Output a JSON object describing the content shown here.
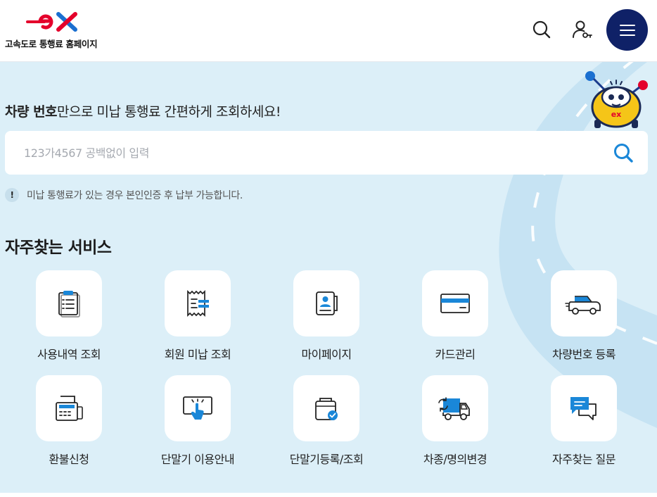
{
  "header": {
    "logo_text": "고속도로 통행료 홈페이지",
    "search_icon": "search-icon",
    "user_icon": "user-key-icon",
    "menu_icon": "hamburger-menu-icon"
  },
  "colors": {
    "brand_navy": "#0f2167",
    "accent_blue": "#1a87d8",
    "logo_red": "#e4002b",
    "background": "#dceff8"
  },
  "hero": {
    "headline_bold": "차량 번호",
    "headline_rest": "만으로 미납 통행료 간편하게 조회하세요!",
    "search_placeholder": "123가4567 공백없이 입력",
    "search_value": "",
    "notice_icon": "!",
    "notice_text": "미납 통행료가 있는 경우 본인인증 후 납부 가능합니다."
  },
  "services": {
    "title": "자주찾는 서비스",
    "items": [
      {
        "label": "사용내역 조회",
        "icon": "clipboard-list-icon"
      },
      {
        "label": "회원 미납 조회",
        "icon": "receipt-icon"
      },
      {
        "label": "마이페이지",
        "icon": "profile-card-icon"
      },
      {
        "label": "카드관리",
        "icon": "credit-card-icon"
      },
      {
        "label": "차량번호 등록",
        "icon": "car-icon"
      },
      {
        "label": "환불신청",
        "icon": "fax-machine-icon"
      },
      {
        "label": "단말기 이용안내",
        "icon": "touch-screen-icon"
      },
      {
        "label": "단말기등록/조회",
        "icon": "device-check-icon"
      },
      {
        "label": "차종/명의변경",
        "icon": "truck-exchange-icon"
      },
      {
        "label": "자주찾는 질문",
        "icon": "chat-bubbles-icon"
      }
    ]
  }
}
